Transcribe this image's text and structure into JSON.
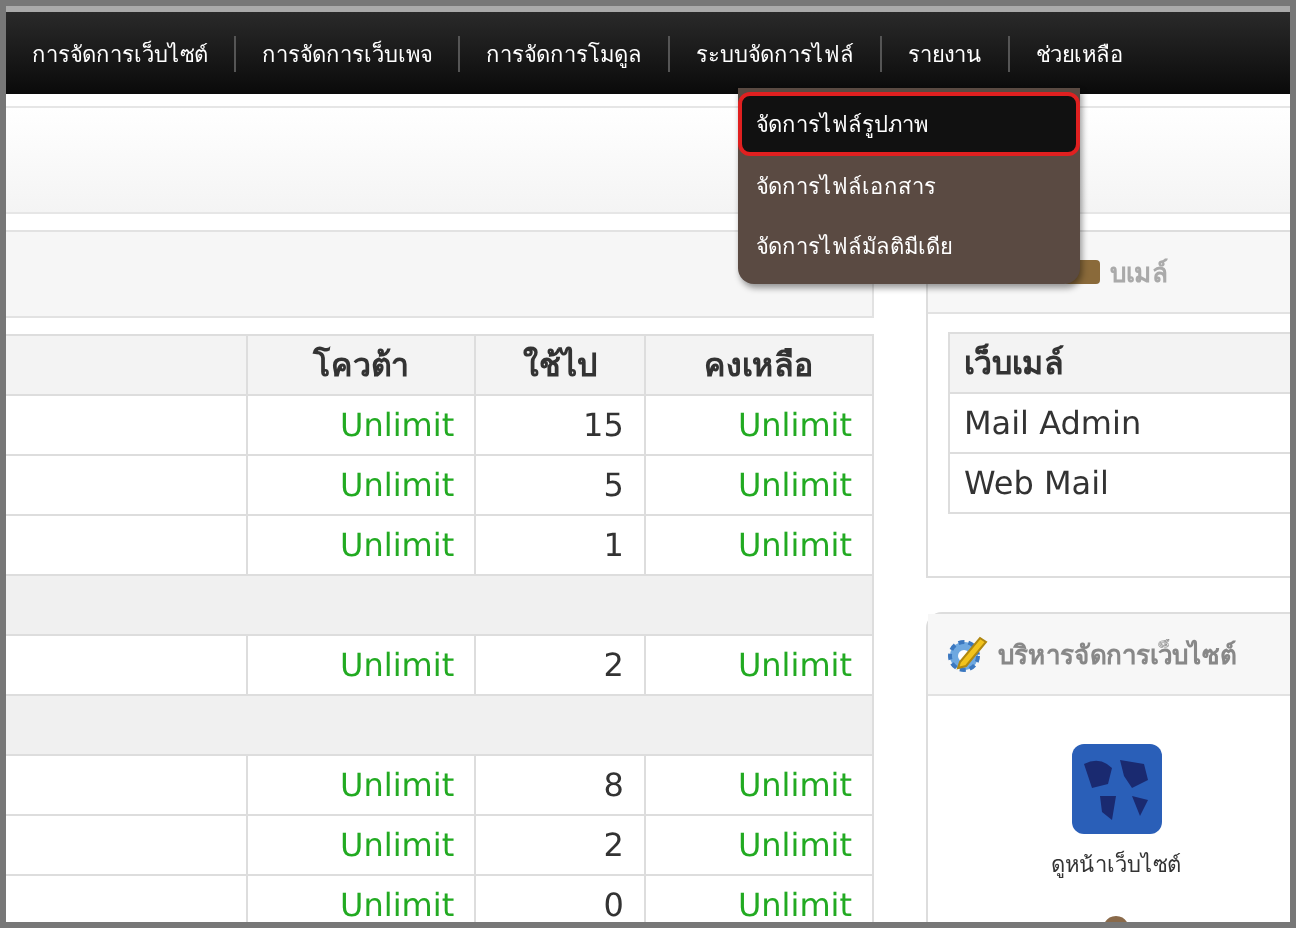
{
  "nav": {
    "items": [
      {
        "label": "การจัดการเว็บไซต์"
      },
      {
        "label": "การจัดการเว็บเพจ"
      },
      {
        "label": "การจัดการโมดูล"
      },
      {
        "label": "ระบบจัดการไฟล์"
      },
      {
        "label": "รายงาน"
      },
      {
        "label": "ช่วยเหลือ"
      }
    ]
  },
  "dropdown": {
    "items": [
      {
        "label": "จัดการไฟล์รูปภาพ",
        "selected": true
      },
      {
        "label": "จัดการไฟล์เอกสาร",
        "selected": false
      },
      {
        "label": "จัดการไฟล์มัลติมีเดีย",
        "selected": false
      }
    ]
  },
  "quota_table": {
    "columns": [
      "โควต้า",
      "ใช้ไป",
      "คงเหลือ"
    ],
    "rows": [
      {
        "kind": "item",
        "quota": "Unlimit",
        "used": "15",
        "remaining": "Unlimit"
      },
      {
        "kind": "item",
        "quota": "Unlimit",
        "used": "5",
        "remaining": "Unlimit"
      },
      {
        "kind": "item",
        "quota": "Unlimit",
        "used": "1",
        "remaining": "Unlimit"
      },
      {
        "kind": "section"
      },
      {
        "kind": "item",
        "quota": "Unlimit",
        "used": "2",
        "remaining": "Unlimit"
      },
      {
        "kind": "section"
      },
      {
        "kind": "item",
        "quota": "Unlimit",
        "used": "8",
        "remaining": "Unlimit"
      },
      {
        "kind": "item",
        "quota": "Unlimit",
        "used": "2",
        "remaining": "Unlimit"
      },
      {
        "kind": "item",
        "quota": "Unlimit",
        "used": "0",
        "remaining": "Unlimit"
      }
    ]
  },
  "webmail_panel": {
    "title": "บเมล์",
    "table": {
      "column": "เว็บเมล์",
      "rows": [
        "Mail Admin",
        "Web Mail"
      ]
    }
  },
  "admin_panel": {
    "title": "บริหารจัดการเว็บไซต์",
    "shortcuts": [
      {
        "label": "ดูหน้าเว็บไซต์"
      }
    ]
  }
}
